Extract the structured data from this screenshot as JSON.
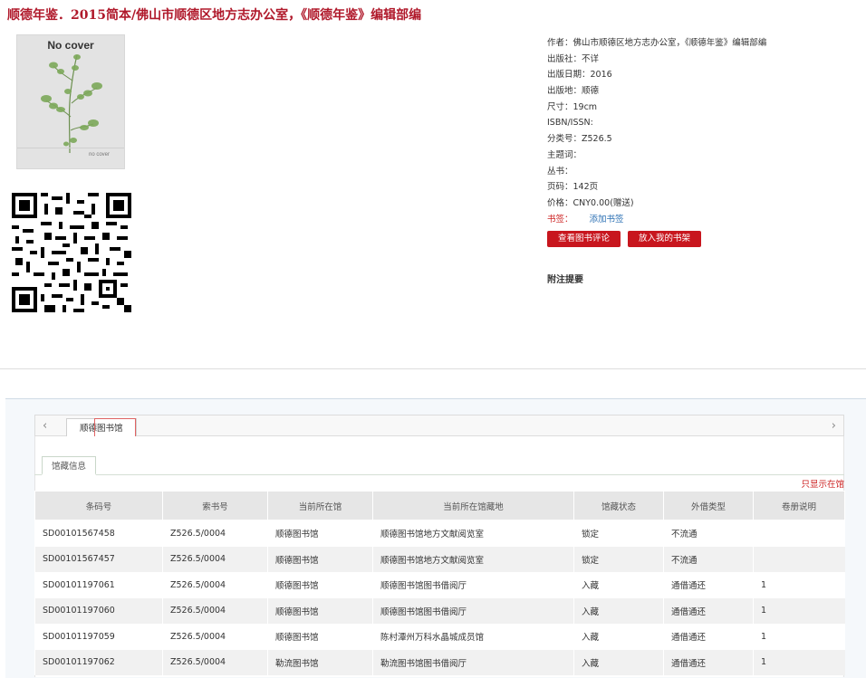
{
  "title": "顺德年鉴．2015简本/佛山市顺德区地方志办公室，《顺德年鉴》编辑部编",
  "cover": {
    "title": "No cover",
    "subtitle": "no cover"
  },
  "meta": {
    "author": "作者：佛山市顺德区地方志办公室，《顺德年鉴》编辑部编",
    "publisher": "出版社：不详",
    "pub_date": "出版日期：2016",
    "pub_place": "出版地：顺德",
    "size": "尺寸：19cm",
    "isbn": "ISBN/ISSN:",
    "classification": "分类号：Z526.5",
    "subject": "主题词：",
    "series": "丛书：",
    "pages": "页码：142页",
    "price": "价格：CNY0.00(赠送)",
    "bookmark_label": "书签：",
    "bookmark_link": "添加书签"
  },
  "buttons": {
    "review": "查看图书评论",
    "shelf": "放入我的书架"
  },
  "note_label": "附注提要",
  "tabs": {
    "library": "顺德图书馆",
    "prev": "‹",
    "next": "›"
  },
  "subtab": "馆藏信息",
  "only_show": "只显示在馆",
  "table": {
    "headers": [
      "条码号",
      "索书号",
      "当前所在馆",
      "当前所在馆藏地",
      "馆藏状态",
      "外借类型",
      "卷册说明"
    ],
    "rows": [
      [
        "SD00101567458",
        "Z526.5/0004",
        "顺德图书馆",
        "顺德图书馆地方文献阅览室",
        "锁定",
        "不流通",
        ""
      ],
      [
        "SD00101567457",
        "Z526.5/0004",
        "顺德图书馆",
        "顺德图书馆地方文献阅览室",
        "锁定",
        "不流通",
        ""
      ],
      [
        "SD00101197061",
        "Z526.5/0004",
        "顺德图书馆",
        "顺德图书馆图书借阅厅",
        "入藏",
        "通借通还",
        "1"
      ],
      [
        "SD00101197060",
        "Z526.5/0004",
        "顺德图书馆",
        "顺德图书馆图书借阅厅",
        "入藏",
        "通借通还",
        "1"
      ],
      [
        "SD00101197059",
        "Z526.5/0004",
        "顺德图书馆",
        "陈村潭州万科水晶城成员馆",
        "入藏",
        "通借通还",
        "1"
      ],
      [
        "SD00101197062",
        "Z526.5/0004",
        "勒流图书馆",
        "勒流图书馆图书借阅厅",
        "入藏",
        "通借通还",
        "1"
      ]
    ]
  },
  "colors": {
    "brand_red": "#b0192b",
    "button_red": "#c8161e",
    "link_blue": "#2a6fb3"
  }
}
